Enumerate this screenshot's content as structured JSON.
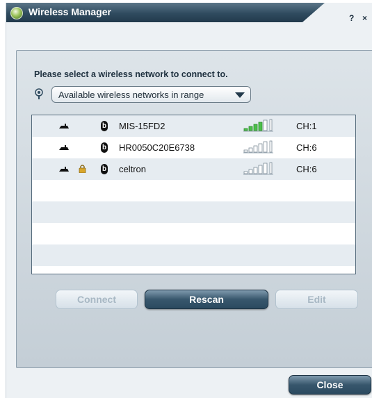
{
  "window": {
    "title": "Wireless Manager",
    "help_label": "?",
    "close_label": "×"
  },
  "instruction": "Please select a wireless network to connect to.",
  "filter": {
    "selected": "Available wireless networks in range"
  },
  "networks": [
    {
      "ssid": "MIS-15FD2",
      "locked": false,
      "signal_bars": 4,
      "signal_color": "#4cc04a",
      "channel": "CH:1",
      "band_badge": "b"
    },
    {
      "ssid": "HR0050C20E6738",
      "locked": false,
      "signal_bars": 0,
      "signal_color": "#4cc04a",
      "channel": "CH:6",
      "band_badge": "b"
    },
    {
      "ssid": "celtron",
      "locked": true,
      "signal_bars": 0,
      "signal_color": "#4cc04a",
      "channel": "CH:6",
      "band_badge": "b"
    }
  ],
  "empty_rows": 4,
  "buttons": {
    "connect": "Connect",
    "rescan": "Rescan",
    "edit": "Edit",
    "close": "Close"
  },
  "colors": {
    "title_bar": "#2f4b5f",
    "primary_button": "#38576d",
    "row_alt": "#e6ecf1"
  }
}
